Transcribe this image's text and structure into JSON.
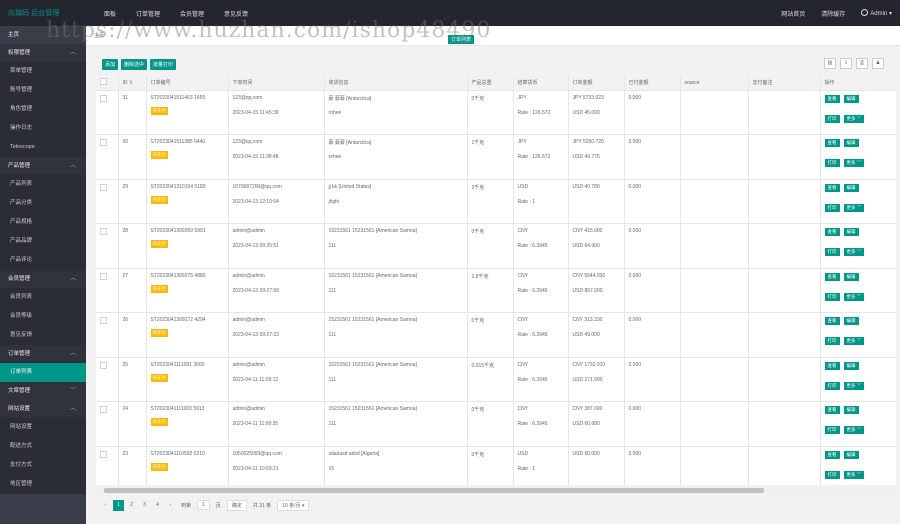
{
  "topbar": {
    "logo": "向瑞码·后台管理",
    "nav": [
      "面板",
      "订单管理",
      "会员管理",
      "意见反馈"
    ],
    "right": [
      "网站首页",
      "清除缓存"
    ],
    "user": "Admin"
  },
  "watermark": "https://www.huzhan.com/ishop48490",
  "sidebar": {
    "home": "主页",
    "groups": [
      {
        "label": "权限管理",
        "items": [
          "菜单管理",
          "账号管理",
          "角色管理",
          "操作日志",
          "Telescope"
        ]
      },
      {
        "label": "产品管理",
        "items": [
          "产品列表",
          "产品分类",
          "产品规格",
          "产品品牌",
          "产品评论"
        ]
      },
      {
        "label": "会员管理",
        "items": [
          "会员列表",
          "会员等级",
          "意见反馈"
        ]
      },
      {
        "label": "订单管理",
        "items": [
          "订单列表"
        ]
      },
      {
        "label": "文章管理",
        "items": []
      },
      {
        "label": "网站设置",
        "items": [
          "网站设置",
          "配送方式",
          "支付方式",
          "地区管理"
        ]
      }
    ]
  },
  "tabs": {
    "home": "主页",
    "active": "订单列表"
  },
  "toolbar": {
    "add": "添加",
    "delete": "删除选中",
    "print": "批量打印"
  },
  "table": {
    "headers": [
      "",
      "ID",
      "订单编号",
      "下单时间",
      "收货信息",
      "产品总重",
      "结算货币",
      "订单金额",
      "已付金额",
      "source",
      "支付备注",
      "操作"
    ],
    "status_badge": "待支付",
    "ops": {
      "view": "查看",
      "edit": "编辑",
      "print": "打印",
      "more": "更多"
    },
    "rows": [
      {
        "id": "31",
        "no": "ST2023041511463 1659",
        "email": "123@qq.com",
        "time": "2023-04-15 11:45:39",
        "addr": "蔡 蔡蔡 [Antarctica]",
        "addr2": "rohee",
        "weight": "0千克",
        "cur": "JPY",
        "rate": "Rate : 126.572",
        "amt": "JPY 5733.023",
        "amt2": "USD 45.000",
        "paid": "0.000"
      },
      {
        "id": "30",
        "no": "ST2023041511385 9440",
        "email": "123@qq.com",
        "time": "2023-04-15 11:38:48",
        "addr": "蔡 蔡蔡 [Antarctica]",
        "addr2": "rehee",
        "weight": "1千克",
        "cur": "JPY",
        "rate": "Rate : 126.572",
        "amt": "JPY 5250.720",
        "amt2": "USD 49.776",
        "paid": "0.000"
      },
      {
        "id": "29",
        "no": "ST2023041310104 5183",
        "email": "1070087200@qq.com",
        "time": "2023-04-13 12:10:04",
        "addr": "jj kk [United States]",
        "addr2": "jhgfo",
        "weight": "3千克",
        "cur": "USD",
        "rate": "Rate : 1",
        "amt": "USD 40.780",
        "amt2": "",
        "paid": "0.000"
      },
      {
        "id": "28",
        "no": "ST2023041309359 5991",
        "email": "admin@admin",
        "time": "2023-04-13 09:35:51",
        "addr": "15231561 15231561 [American Samoa]",
        "addr2": "111",
        "weight": "0千克",
        "cur": "CNY",
        "rate": "Rate : 6.3945",
        "amt": "CNY 415.000",
        "amt2": "USD 64.900",
        "paid": "0.000"
      },
      {
        "id": "27",
        "no": "ST2023041309275 4880",
        "email": "admin@admin",
        "time": "2023-04-13 09:27:58",
        "addr": "15231561 15231561 [American Samoa]",
        "addr2": "111",
        "weight": "2.8千克",
        "cur": "CNY",
        "rate": "Rate : 6.3945",
        "amt": "CNY 5544.030",
        "amt2": "USD 867.000",
        "paid": "0.000"
      },
      {
        "id": "26",
        "no": "ST2023041309272 4294",
        "email": "admin@admin",
        "time": "2023-04-13 09:27:23",
        "addr": "15231561 15231561 [American Samoa]",
        "addr2": "111",
        "weight": "0千克",
        "cur": "CNY",
        "rate": "Rate : 6.3945",
        "amt": "CNY 313.330",
        "amt2": "USD 49.000",
        "paid": "0.000"
      },
      {
        "id": "25",
        "no": "ST2023041111091 3500",
        "email": "admin@admin",
        "time": "2023-04-11 11:09:12",
        "addr": "15231561 15231561 [American Samoa]",
        "addr2": "111",
        "weight": "0.015千克",
        "cur": "CNY",
        "rate": "Rate : 6.3945",
        "amt": "CNY 1732.910",
        "amt2": "USD 271.000",
        "paid": "0.000"
      },
      {
        "id": "24",
        "no": "ST2023041111003 5913",
        "email": "admin@admin",
        "time": "2023-04-11 11:00:35",
        "addr": "15231561 15231561 [American Samoa]",
        "addr2": "111",
        "weight": "0千克",
        "cur": "CNY",
        "rate": "Rate : 6.3945",
        "amt": "CNY 387.690",
        "amt2": "USD 60.680",
        "paid": "0.000"
      },
      {
        "id": "23",
        "no": "ST2023041110592 0210",
        "email": "1050025093@qq.com",
        "time": "2023-04-11 10:59:21",
        "addr": "sdadasd adsd [Algeria]",
        "addr2": "15",
        "weight": "0千克",
        "cur": "USD",
        "rate": "Rate : 1",
        "amt": "USD 60.000",
        "amt2": "",
        "paid": "0.000"
      }
    ]
  },
  "pager": {
    "pages": [
      "1",
      "2",
      "3",
      "4"
    ],
    "next": "›",
    "prev": "‹",
    "goto_label": "到第",
    "goto_value": "1",
    "page_unit": "页",
    "confirm": "确定",
    "total": "共 31 条",
    "per_page": "10 条/页"
  }
}
